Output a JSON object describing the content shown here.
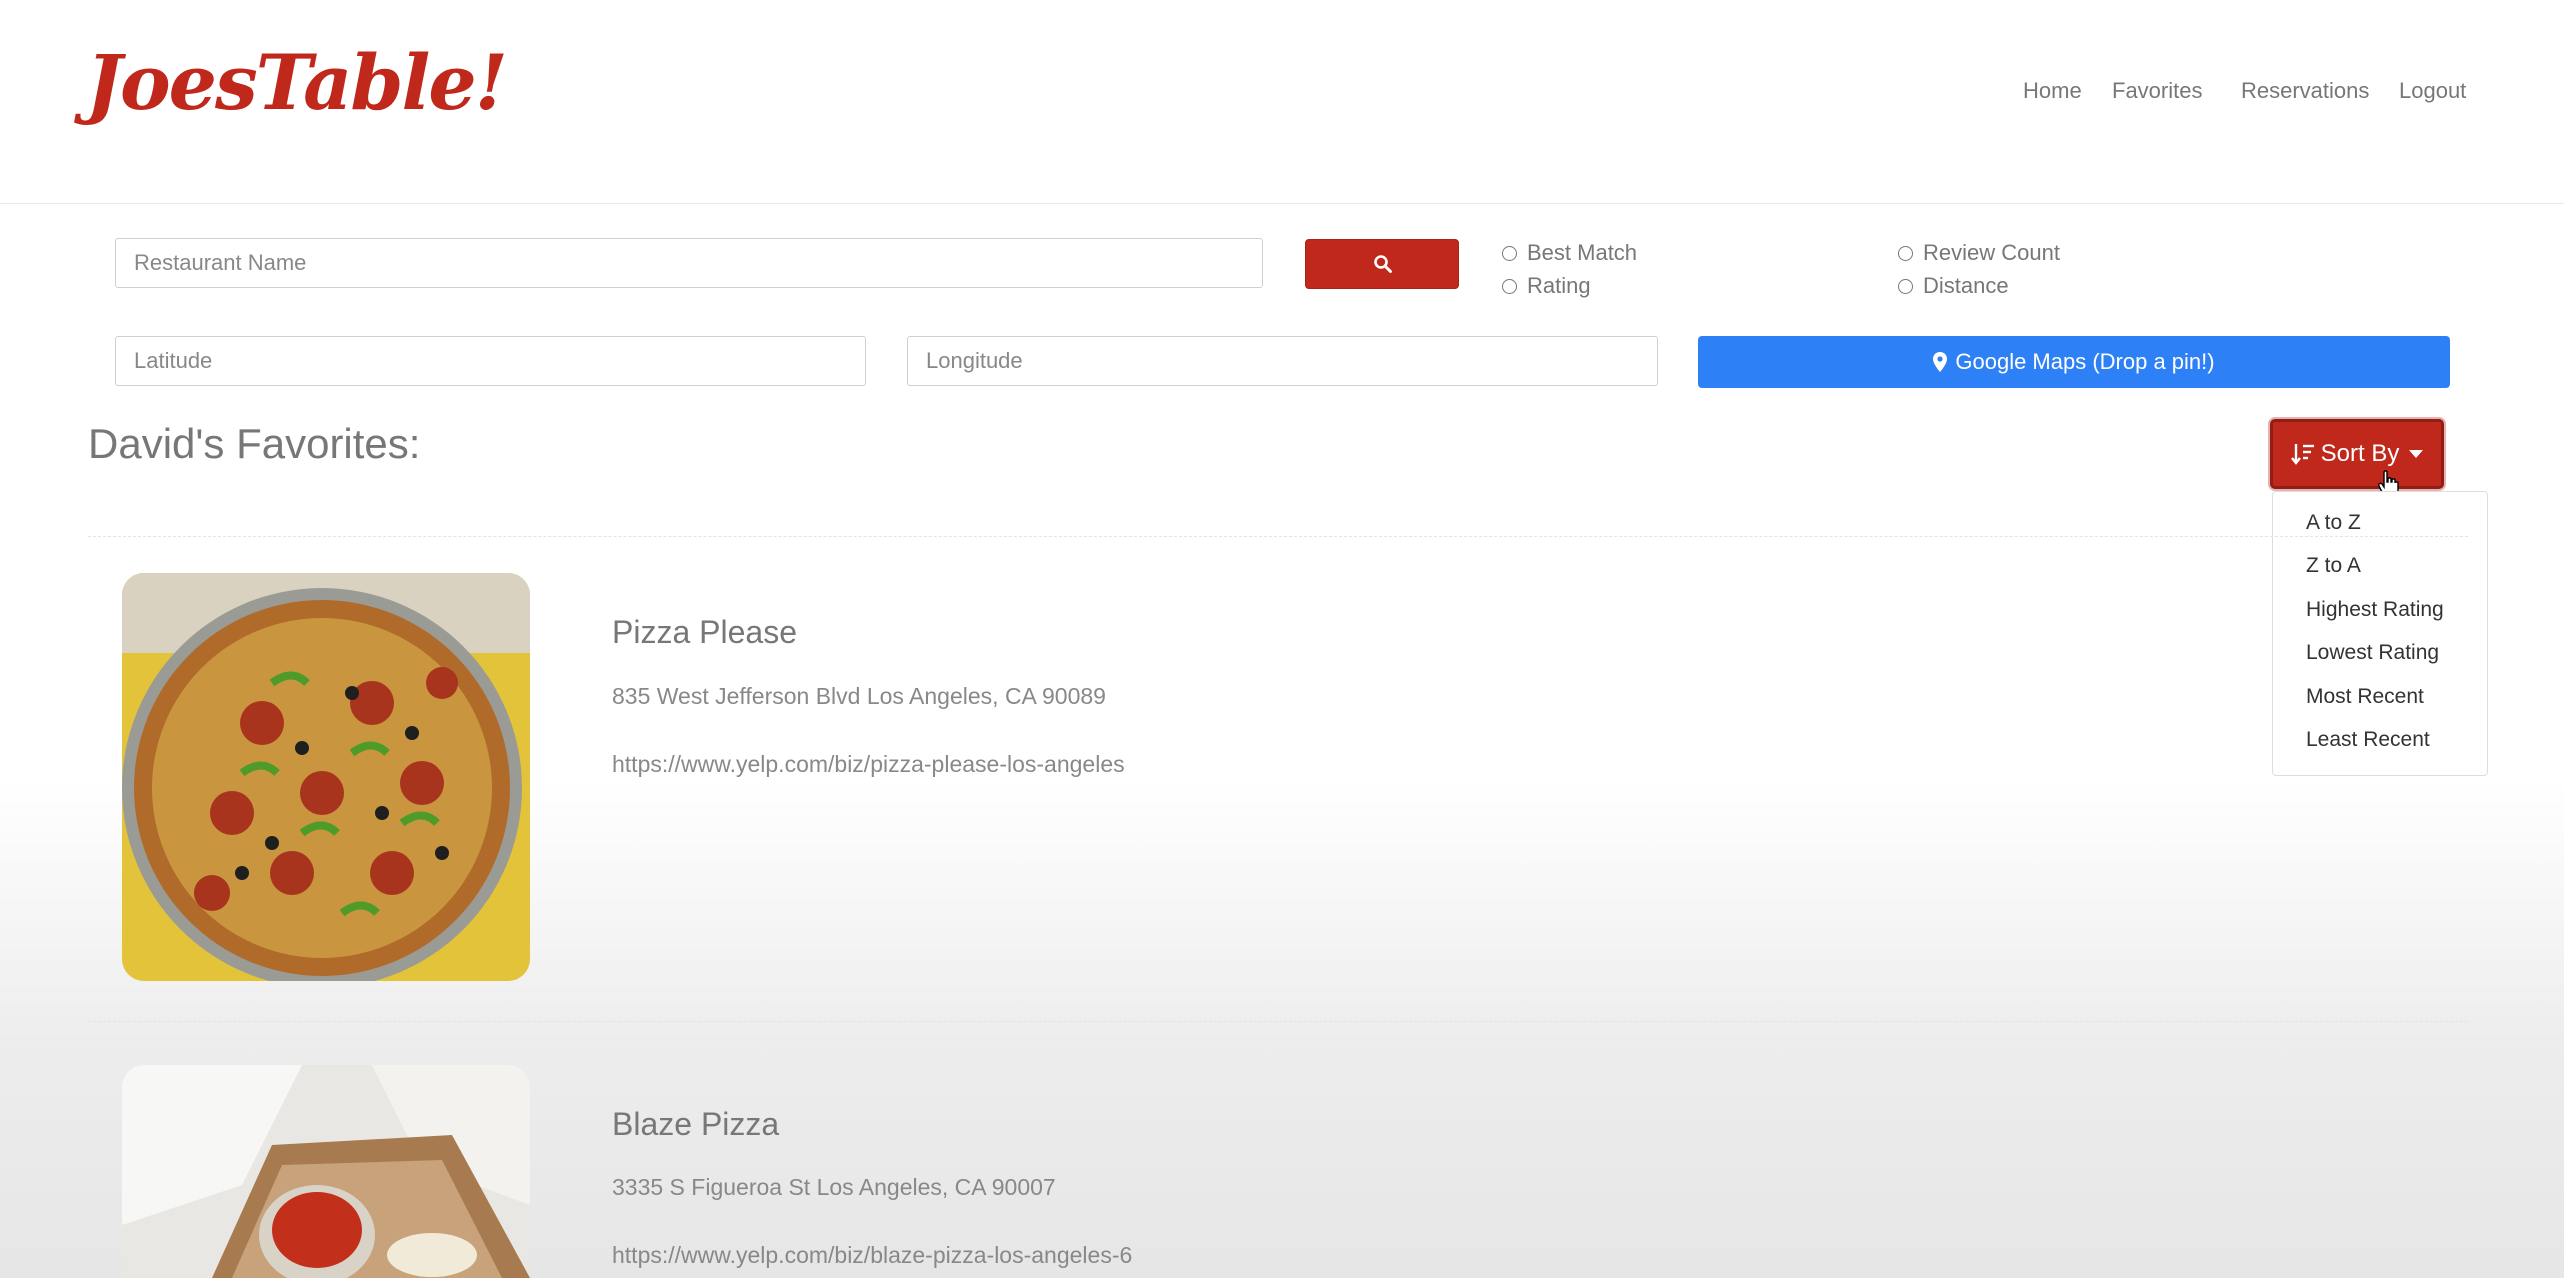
{
  "header": {
    "logo": "JoesTable!",
    "nav": [
      "Home",
      "Favorites",
      "Reservations",
      "Logout"
    ]
  },
  "search": {
    "name_placeholder": "Restaurant Name",
    "lat_placeholder": "Latitude",
    "lng_placeholder": "Longitude",
    "maps_label": "Google Maps (Drop a pin!)",
    "radio_options": [
      "Best Match",
      "Rating",
      "Review Count",
      "Distance"
    ]
  },
  "favorites": {
    "title": "David's Favorites:",
    "sort_label": "Sort By",
    "sort_options": [
      "A to Z",
      "Z to A",
      "Highest Rating",
      "Lowest Rating",
      "Most Recent",
      "Least Recent"
    ]
  },
  "restaurants": [
    {
      "name": "Pizza Please",
      "address": "835 West Jefferson Blvd Los Angeles, CA 90089",
      "url": "https://www.yelp.com/biz/pizza-please-los-angeles"
    },
    {
      "name": "Blaze Pizza",
      "address": "3335 S Figueroa St Los Angeles, CA 90007",
      "url": "https://www.yelp.com/biz/blaze-pizza-los-angeles-6"
    }
  ],
  "colors": {
    "brand_red": "#c0281c",
    "maps_blue": "#2d80f5"
  }
}
